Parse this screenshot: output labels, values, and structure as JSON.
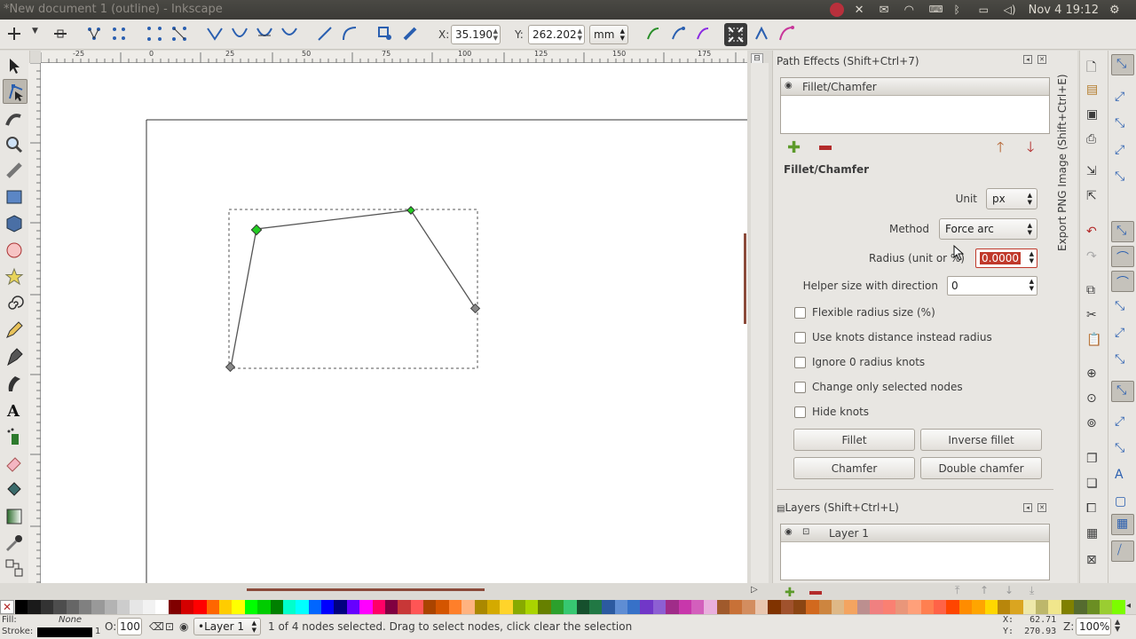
{
  "window": {
    "title": "*New document 1 (outline) - Inkscape",
    "clock": "Nov 4 19:12"
  },
  "toolbar": {
    "x_label": "X:",
    "x_value": "35.190",
    "y_label": "Y:",
    "y_value": "262.202",
    "unit": "mm"
  },
  "ruler": {
    "top_ticks": [
      "-25",
      "0",
      "25",
      "50",
      "75",
      "100",
      "125",
      "150",
      "175"
    ]
  },
  "path_effects": {
    "title": "Path Effects  (Shift+Ctrl+7)",
    "effect_list": [
      "Fillet/Chamfer"
    ],
    "section_title": "Fillet/Chamfer",
    "unit_label": "Unit",
    "unit_value": "px",
    "method_label": "Method",
    "method_value": "Force arc",
    "radius_label": "Radius (unit or %)",
    "radius_value": "0.0000",
    "helper_label": "Helper size with direction",
    "helper_value": "0",
    "checkboxes": [
      "Flexible radius size (%)",
      "Use knots distance instead radius",
      "Ignore 0 radius knots",
      "Change only selected nodes",
      "Hide knots"
    ],
    "buttons": {
      "fillet": "Fillet",
      "inverse_fillet": "Inverse fillet",
      "chamfer": "Chamfer",
      "double_chamfer": "Double chamfer"
    }
  },
  "layers": {
    "title": "Layers (Shift+Ctrl+L)",
    "items": [
      "Layer 1"
    ]
  },
  "side_tab": "Export PNG Image (Shift+Ctrl+E)",
  "status": {
    "fill_label": "Fill:",
    "fill_value": "None",
    "stroke_label": "Stroke:",
    "stroke_width": "1",
    "opacity_label": "O:",
    "opacity_value": "100",
    "layer_value": "•Layer 1",
    "message": "1 of 4 nodes selected. Drag to select nodes, click clear the selection",
    "cursor_x": "X:   62.71",
    "cursor_y": "Y:  270.93",
    "zoom_label": "Z:",
    "zoom_value": "100%"
  },
  "colors": {
    "node_selected": "#22cc22",
    "node_normal": "#777777",
    "accent": "#c0392b"
  },
  "palette": [
    "#000000",
    "#1a1a1a",
    "#333333",
    "#4d4d4d",
    "#666666",
    "#808080",
    "#999999",
    "#b3b3b3",
    "#cccccc",
    "#e6e6e6",
    "#f2f2f2",
    "#ffffff",
    "#800000",
    "#d40000",
    "#ff0000",
    "#ff6600",
    "#ffcc00",
    "#ffff00",
    "#00ff00",
    "#00cc00",
    "#008000",
    "#00ffcc",
    "#00ffff",
    "#0066ff",
    "#0000ff",
    "#000080",
    "#6600ff",
    "#ff00ff",
    "#ff0066",
    "#800040",
    "#c83737",
    "#ff5555",
    "#aa4400",
    "#d45500",
    "#ff7f2a",
    "#ffb380",
    "#aa8800",
    "#d4aa00",
    "#ffd42a",
    "#88aa00",
    "#aad400",
    "#668000",
    "#2ca02c",
    "#37c871",
    "#16502d",
    "#217844",
    "#2c5aa0",
    "#5f8dd3",
    "#3771c8",
    "#7137c8",
    "#8d5fd3",
    "#a02c89",
    "#c837ab",
    "#d35fbc",
    "#e9afdd",
    "#a05a2c",
    "#c87137",
    "#d38d5f",
    "#e9c6af",
    "#803300",
    "#a0522d",
    "#8b4513",
    "#d2691e",
    "#cd853f",
    "#deb887",
    "#f4a460",
    "#bc8f8f",
    "#f08080",
    "#fa8072",
    "#e9967a",
    "#ffa07a",
    "#ff7f50",
    "#ff6347",
    "#ff4500",
    "#ff8c00",
    "#ffa500",
    "#ffd700",
    "#b8860b",
    "#daa520",
    "#eee8aa",
    "#bdb76b",
    "#f0e68c",
    "#808000",
    "#556b2f",
    "#6b8e23",
    "#9acd32",
    "#7cfc00"
  ]
}
